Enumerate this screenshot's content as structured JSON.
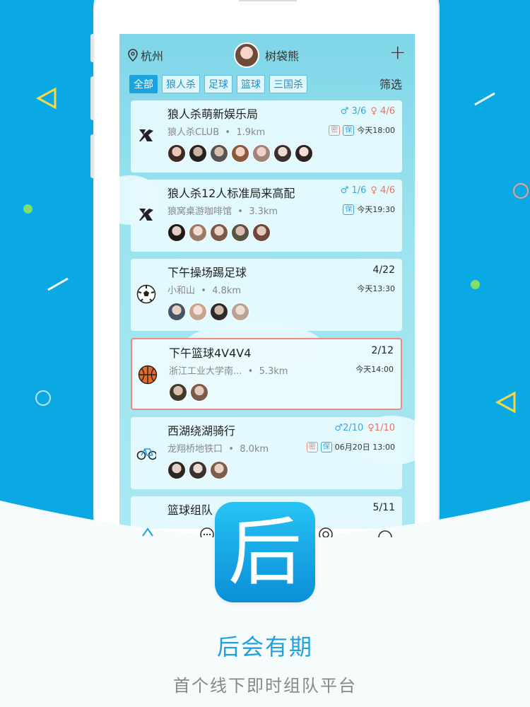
{
  "topbar": {
    "city": "杭州",
    "username": "树袋熊",
    "add": "+"
  },
  "filters": {
    "chips": [
      "全部",
      "狼人杀",
      "足球",
      "篮球",
      "三国杀"
    ],
    "filter_label": "筛选"
  },
  "cards": [
    {
      "title": "狼人杀萌新娱乐局",
      "place": "狼人杀CLUB",
      "dist": "1.9km",
      "male": "♂ 3/6",
      "female": "♀ 4/6",
      "badges": [
        "密",
        "保"
      ],
      "time": "今天18:00",
      "icon": "werewolf-icon",
      "avatars": 7
    },
    {
      "title": "狼人杀12人标准局来高配",
      "place": "狼窝桌游咖啡馆",
      "dist": "3.3km",
      "male": "♂ 1/6",
      "female": "♀ 4/6",
      "badges": [
        "保"
      ],
      "time": "今天19:30",
      "icon": "werewolf-icon",
      "avatars": 5
    },
    {
      "title": "下午操场踢足球",
      "place": "小和山",
      "dist": "4.8km",
      "count": "4/22",
      "time": "今天13:30",
      "icon": "soccer-ball-icon",
      "avatars": 4
    },
    {
      "title": "下午篮球4V4V4",
      "place": "浙江工业大学南...",
      "dist": "5.3km",
      "count": "2/12",
      "time": "今天14:00",
      "icon": "basketball-icon",
      "avatars": 2
    },
    {
      "title": "西湖绕湖骑行",
      "place": "龙翔桥地铁口",
      "dist": "8.0km",
      "male": "♂2/10",
      "female": "♀1/10",
      "badges": [
        "密",
        "保"
      ],
      "time": "06月20日 13:00",
      "icon": "bicycle-icon",
      "avatars": 3
    },
    {
      "title": "篮球组队",
      "count": "5/11",
      "icon": "basketball-icon"
    }
  ],
  "separator": "•",
  "brand": {
    "name": "后会有期",
    "slogan": "首个线下即时组队平台",
    "icon_char": "后"
  },
  "colors": {
    "accent": "#1aa3df",
    "male": "#3aa7e0",
    "female": "#e8725f",
    "highlight_border": "#f08a7f"
  }
}
